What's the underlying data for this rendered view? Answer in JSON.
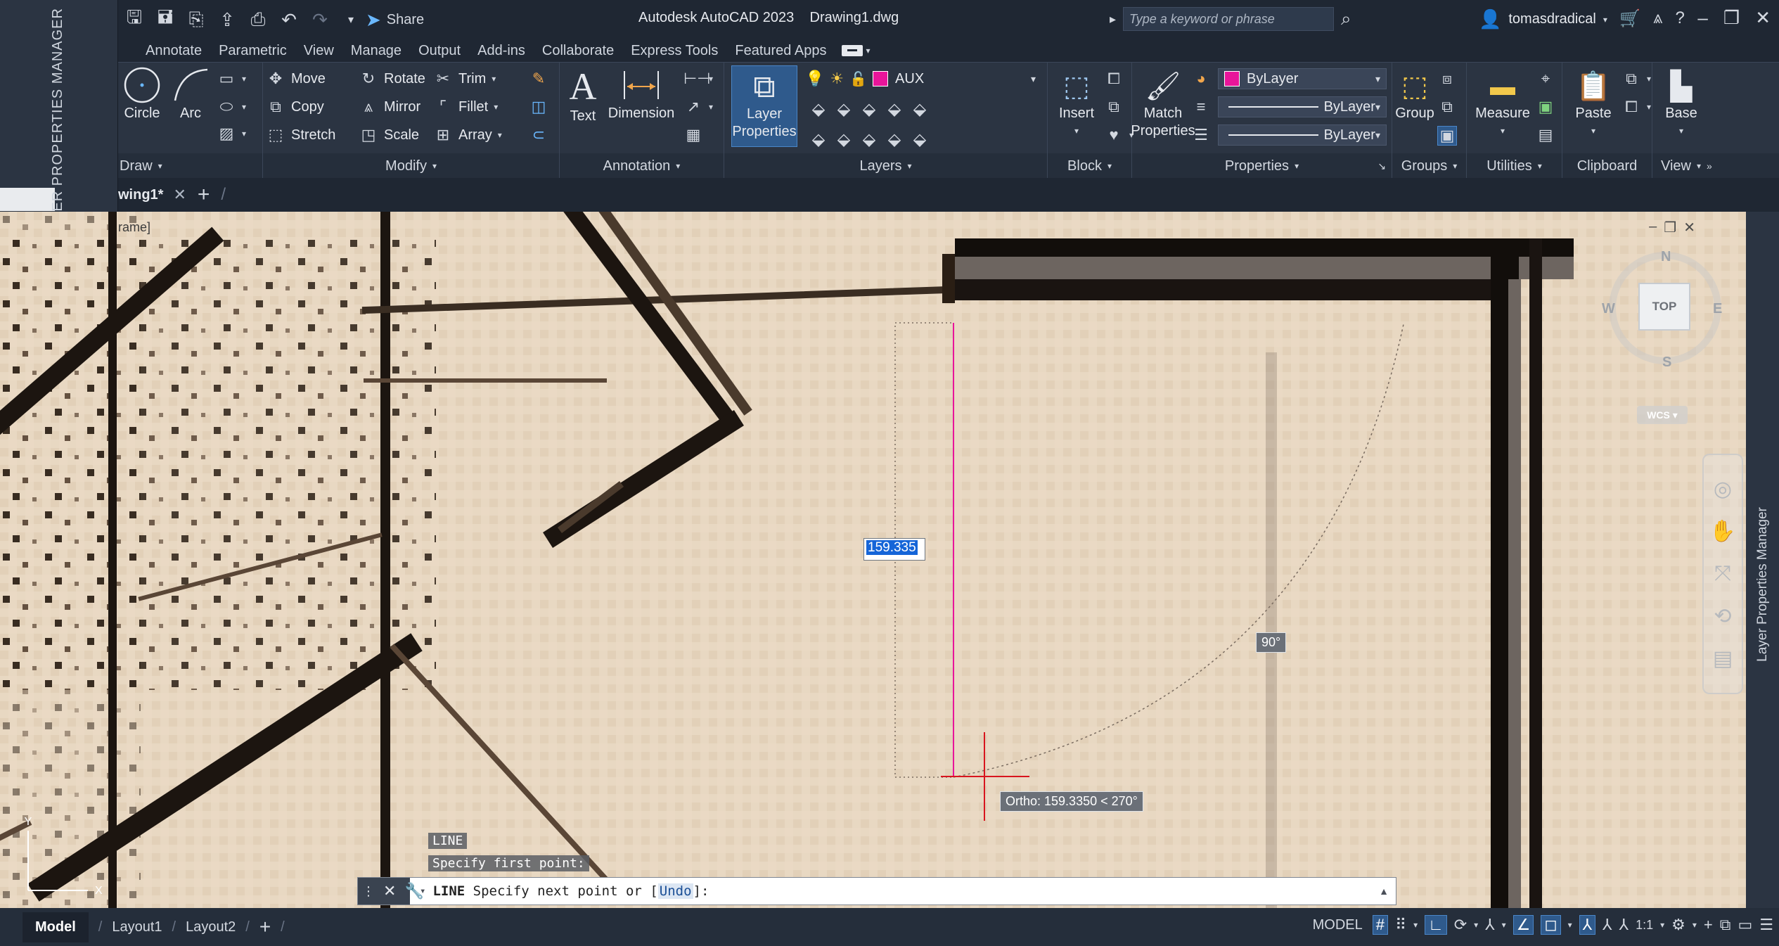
{
  "palette": {
    "title": "LAYER PROPERTIES MANAGER"
  },
  "titlebar": {
    "share_label": "Share",
    "app_title": "Autodesk AutoCAD 2023",
    "doc_title": "Drawing1.dwg",
    "search_placeholder": "Type a keyword or phrase",
    "username": "tomasdradical"
  },
  "tabs": [
    "Annotate",
    "Parametric",
    "View",
    "Manage",
    "Output",
    "Add-ins",
    "Collaborate",
    "Express Tools",
    "Featured Apps"
  ],
  "ribbon": {
    "draw": {
      "circle": "Circle",
      "arc": "Arc",
      "footer": "Draw"
    },
    "modify": {
      "move": "Move",
      "rotate": "Rotate",
      "trim": "Trim",
      "copy": "Copy",
      "mirror": "Mirror",
      "fillet": "Fillet",
      "stretch": "Stretch",
      "scale": "Scale",
      "array": "Array",
      "footer": "Modify"
    },
    "annotation": {
      "text": "Text",
      "dimension": "Dimension",
      "footer": "Annotation"
    },
    "layers": {
      "layer_properties_1": "Layer",
      "layer_properties_2": "Properties",
      "current_layer": "AUX",
      "footer": "Layers"
    },
    "block": {
      "insert": "Insert",
      "footer": "Block"
    },
    "properties": {
      "match_1": "Match",
      "match_2": "Properties",
      "color": "ByLayer",
      "linetype": "ByLayer",
      "lineweight": "ByLayer",
      "footer": "Properties"
    },
    "groups": {
      "group": "Group",
      "footer": "Groups"
    },
    "utilities": {
      "measure": "Measure",
      "footer": "Utilities"
    },
    "clipboard": {
      "paste": "Paste",
      "footer": "Clipboard"
    },
    "view": {
      "base": "Base",
      "footer": "View"
    },
    "accent": "#e8159a"
  },
  "filetab": {
    "name": "wing1*"
  },
  "viewport": {
    "label": "rame]",
    "dynamic_input": "159.335",
    "angle_tip": "90°",
    "ortho_tip": "Ortho: 159.3350 < 270°",
    "viewcube": {
      "face": "TOP",
      "n": "N",
      "s": "S",
      "e": "E",
      "w": "W",
      "wcs": "WCS"
    }
  },
  "command": {
    "history_1": "LINE",
    "history_2": "Specify first point:",
    "cmd": "LINE",
    "prompt_pre": "Specify next point or [",
    "option": "Undo",
    "prompt_post": "]:"
  },
  "side_tab": {
    "title": "Layer Properties Manager"
  },
  "status": {
    "model_tab": "Model",
    "layout1": "Layout1",
    "layout2": "Layout2",
    "model_label": "MODEL",
    "scale": "1:1"
  }
}
